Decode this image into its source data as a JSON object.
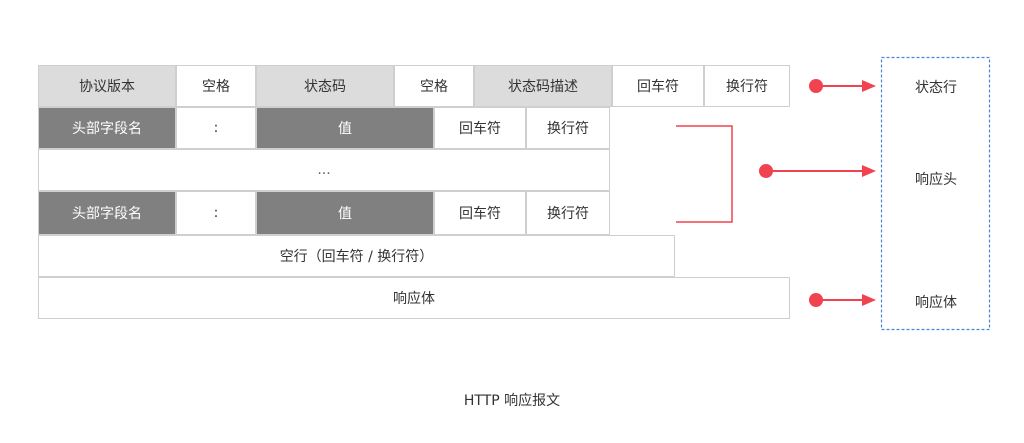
{
  "status_line": {
    "cells": [
      "协议版本",
      "空格",
      "状态码",
      "空格",
      "状态码描述",
      "回车符",
      "换行符"
    ]
  },
  "header_row_1": {
    "cells": [
      "头部字段名",
      ":",
      "值",
      "回车符",
      "换行符"
    ]
  },
  "ellipsis": "...",
  "header_row_2": {
    "cells": [
      "头部字段名",
      ":",
      "值",
      "回车符",
      "换行符"
    ]
  },
  "empty_line": "空行（回车符 / 换行符）",
  "body_row": "响应体",
  "legend": {
    "status_line": "状态行",
    "headers": "响应头",
    "body": "响应体"
  },
  "caption": "HTTP 响应报文",
  "colors": {
    "arrow": "#f0434f",
    "dashed_border": "#4a86d8",
    "light_cell": "#dcdcdc",
    "dark_cell": "#808080"
  }
}
